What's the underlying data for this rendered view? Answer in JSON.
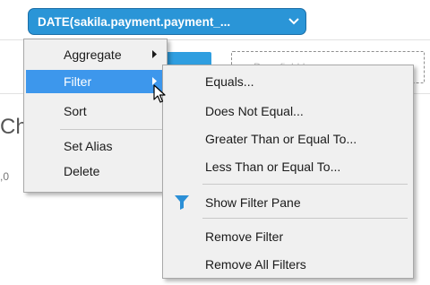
{
  "field_pill": {
    "label": "DATE(sakila.payment.payment_...",
    "chevron_icon": "chevron-down-icon"
  },
  "background": {
    "drop_zone_hint": "Drop field here",
    "chart_text_fragment": "Ch",
    "axis_text_fragment": ",0"
  },
  "context_menu": {
    "items": [
      {
        "label": "Aggregate",
        "has_submenu": true
      },
      {
        "label": "Filter",
        "has_submenu": true,
        "highlighted": true
      },
      {
        "label": "Sort"
      },
      {
        "label": "Set Alias"
      },
      {
        "label": "Delete"
      }
    ]
  },
  "filter_submenu": {
    "items": [
      {
        "label": "Equals..."
      },
      {
        "label": "Does Not Equal..."
      },
      {
        "label": "Greater Than or Equal To..."
      },
      {
        "label": "Less Than or Equal To..."
      },
      {
        "label": "Show Filter Pane",
        "icon": "funnel-icon"
      },
      {
        "label": "Remove Filter"
      },
      {
        "label": "Remove All Filters"
      }
    ]
  },
  "colors": {
    "pill_background": "#2a95d7",
    "menu_highlight": "#3d97ec",
    "menu_background": "#f0f0f0",
    "filter_icon": "#2b8fd6"
  }
}
